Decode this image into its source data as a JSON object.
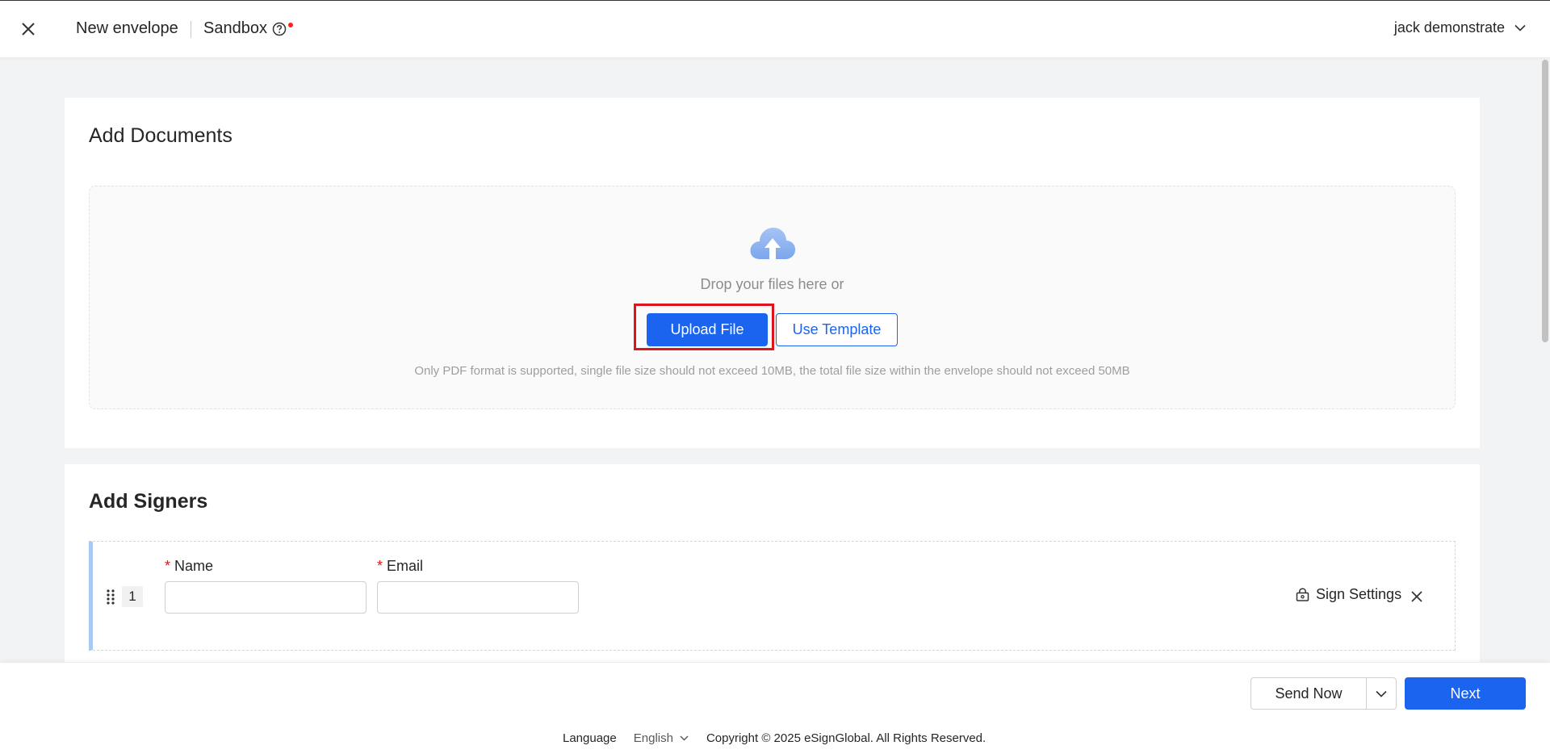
{
  "header": {
    "title": "New envelope",
    "environment": "Sandbox",
    "user_name": "jack demonstrate"
  },
  "documents": {
    "title": "Add Documents",
    "drop_text": "Drop your files here or",
    "upload_label": "Upload File",
    "template_label": "Use Template",
    "hint": "Only PDF format is supported, single file size should not exceed 10MB, the total file size within the envelope should not exceed 50MB"
  },
  "signers": {
    "title": "Add Signers",
    "rows": [
      {
        "index": "1",
        "name_label": "Name",
        "email_label": "Email",
        "name_value": "",
        "email_value": "",
        "required_mark": "*",
        "settings_label": "Sign Settings"
      }
    ]
  },
  "actions": {
    "send_now_label": "Send Now",
    "next_label": "Next"
  },
  "footer": {
    "language_label": "Language",
    "language_value": "English",
    "copyright": "Copyright © 2025 eSignGlobal. All Rights Reserved."
  },
  "colors": {
    "primary": "#1a64f0",
    "highlight": "#e0141c",
    "signer_accent": "#a9c8f2"
  },
  "icons": {
    "close": "close-icon",
    "help": "help-circle-icon",
    "chevron": "chevron-down-icon",
    "upload": "cloud-upload-icon",
    "drag": "drag-handle-icon",
    "lock": "lock-icon"
  }
}
